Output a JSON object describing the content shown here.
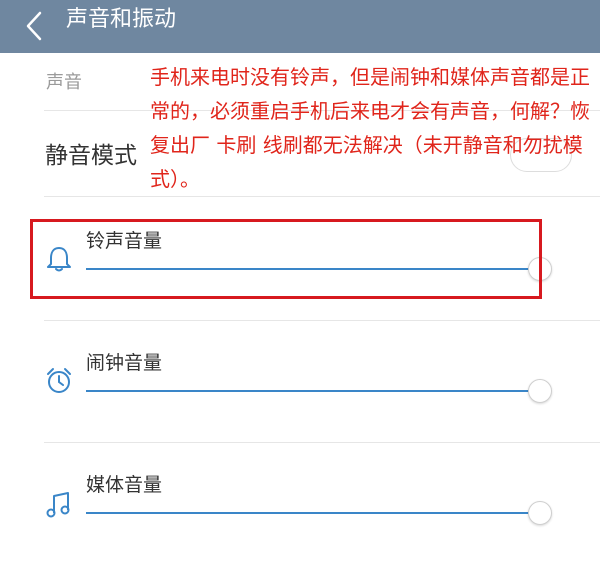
{
  "header": {
    "title": "声音和振动",
    "back_icon": "chevron-left-icon"
  },
  "section": {
    "label": "声音"
  },
  "silent_mode": {
    "label": "静音模式",
    "enabled": false
  },
  "annotation": {
    "text": "手机来电时没有铃声，但是闹钟和媒体声音都是正常的，必须重启手机后来电才会有声音，何解？恢复出厂 卡刷 线刷都无法解决（未开静音和勿扰模式）。"
  },
  "volumes": [
    {
      "label": "铃声音量",
      "icon": "bell-icon",
      "level": 1.0
    },
    {
      "label": "闹钟音量",
      "icon": "alarm-clock-icon",
      "level": 1.0
    },
    {
      "label": "媒体音量",
      "icon": "music-note-icon",
      "level": 1.0
    }
  ],
  "colors": {
    "header_bg": "#6f87a0",
    "accent": "#3a86c8",
    "annotation": "#e0251b",
    "highlight_border": "#d7191f"
  }
}
